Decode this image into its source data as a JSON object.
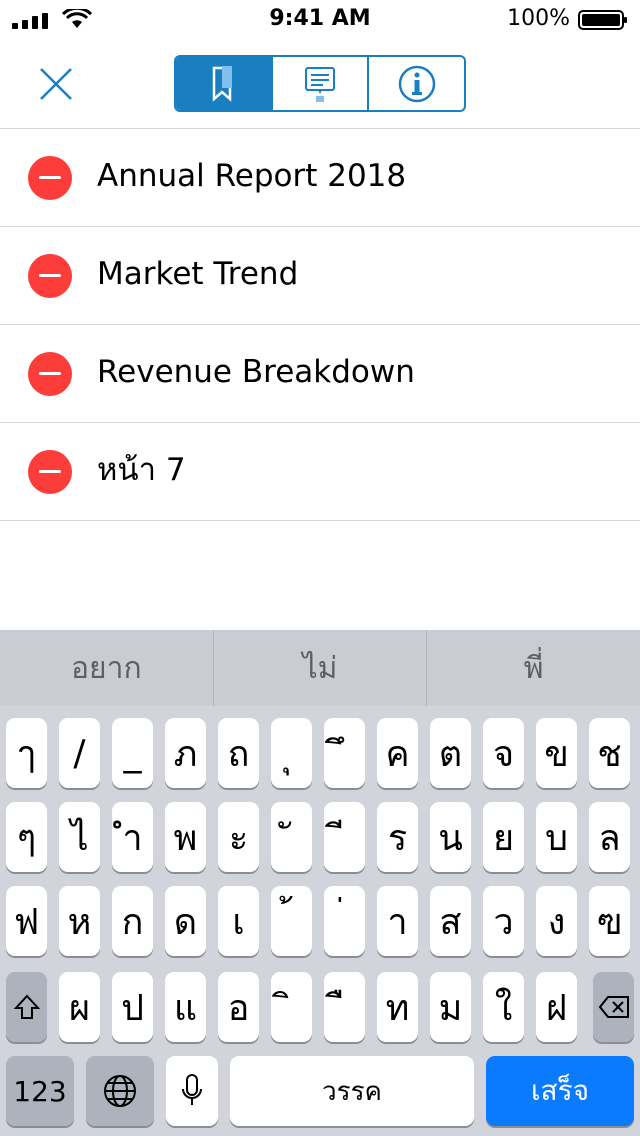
{
  "status_bar": {
    "time": "9:41 AM",
    "battery": "100%"
  },
  "toolbar": {
    "close_icon": "close-icon",
    "segments": [
      {
        "icon": "bookmark-icon",
        "selected": true
      },
      {
        "icon": "comment-icon",
        "selected": false
      },
      {
        "icon": "info-icon",
        "selected": false
      }
    ],
    "accent": "#1a7fc1"
  },
  "list": {
    "items": [
      {
        "label": "Annual Report 2018"
      },
      {
        "label": "Market Trend"
      },
      {
        "label": "Revenue Breakdown"
      },
      {
        "label": "หน้า 7"
      }
    ],
    "delete_color": "#fc3d39"
  },
  "keyboard": {
    "suggestions": [
      "อยาก",
      "ไม่",
      "พี่"
    ],
    "row1": [
      "ๅ",
      "/",
      "_",
      "ภ",
      "ถ",
      "ุ",
      "ึ",
      "ค",
      "ต",
      "จ",
      "ข",
      "ช"
    ],
    "row2": [
      "ๆ",
      "ไ",
      "ำ",
      "พ",
      "ะ",
      "ั",
      "ี",
      "ร",
      "น",
      "ย",
      "บ",
      "ล"
    ],
    "row3": [
      "ฟ",
      "ห",
      "ก",
      "ด",
      "เ",
      "้",
      "่",
      "า",
      "ส",
      "ว",
      "ง",
      "ฃ"
    ],
    "row4": [
      "ผ",
      "ป",
      "แ",
      "อ",
      "ิ",
      "ื",
      "ท",
      "ม",
      "ใ",
      "ฝ"
    ],
    "numbers_label": "123",
    "space_label": "วรรค",
    "done_label": "เสร็จ",
    "done_color": "#0a7aff"
  }
}
